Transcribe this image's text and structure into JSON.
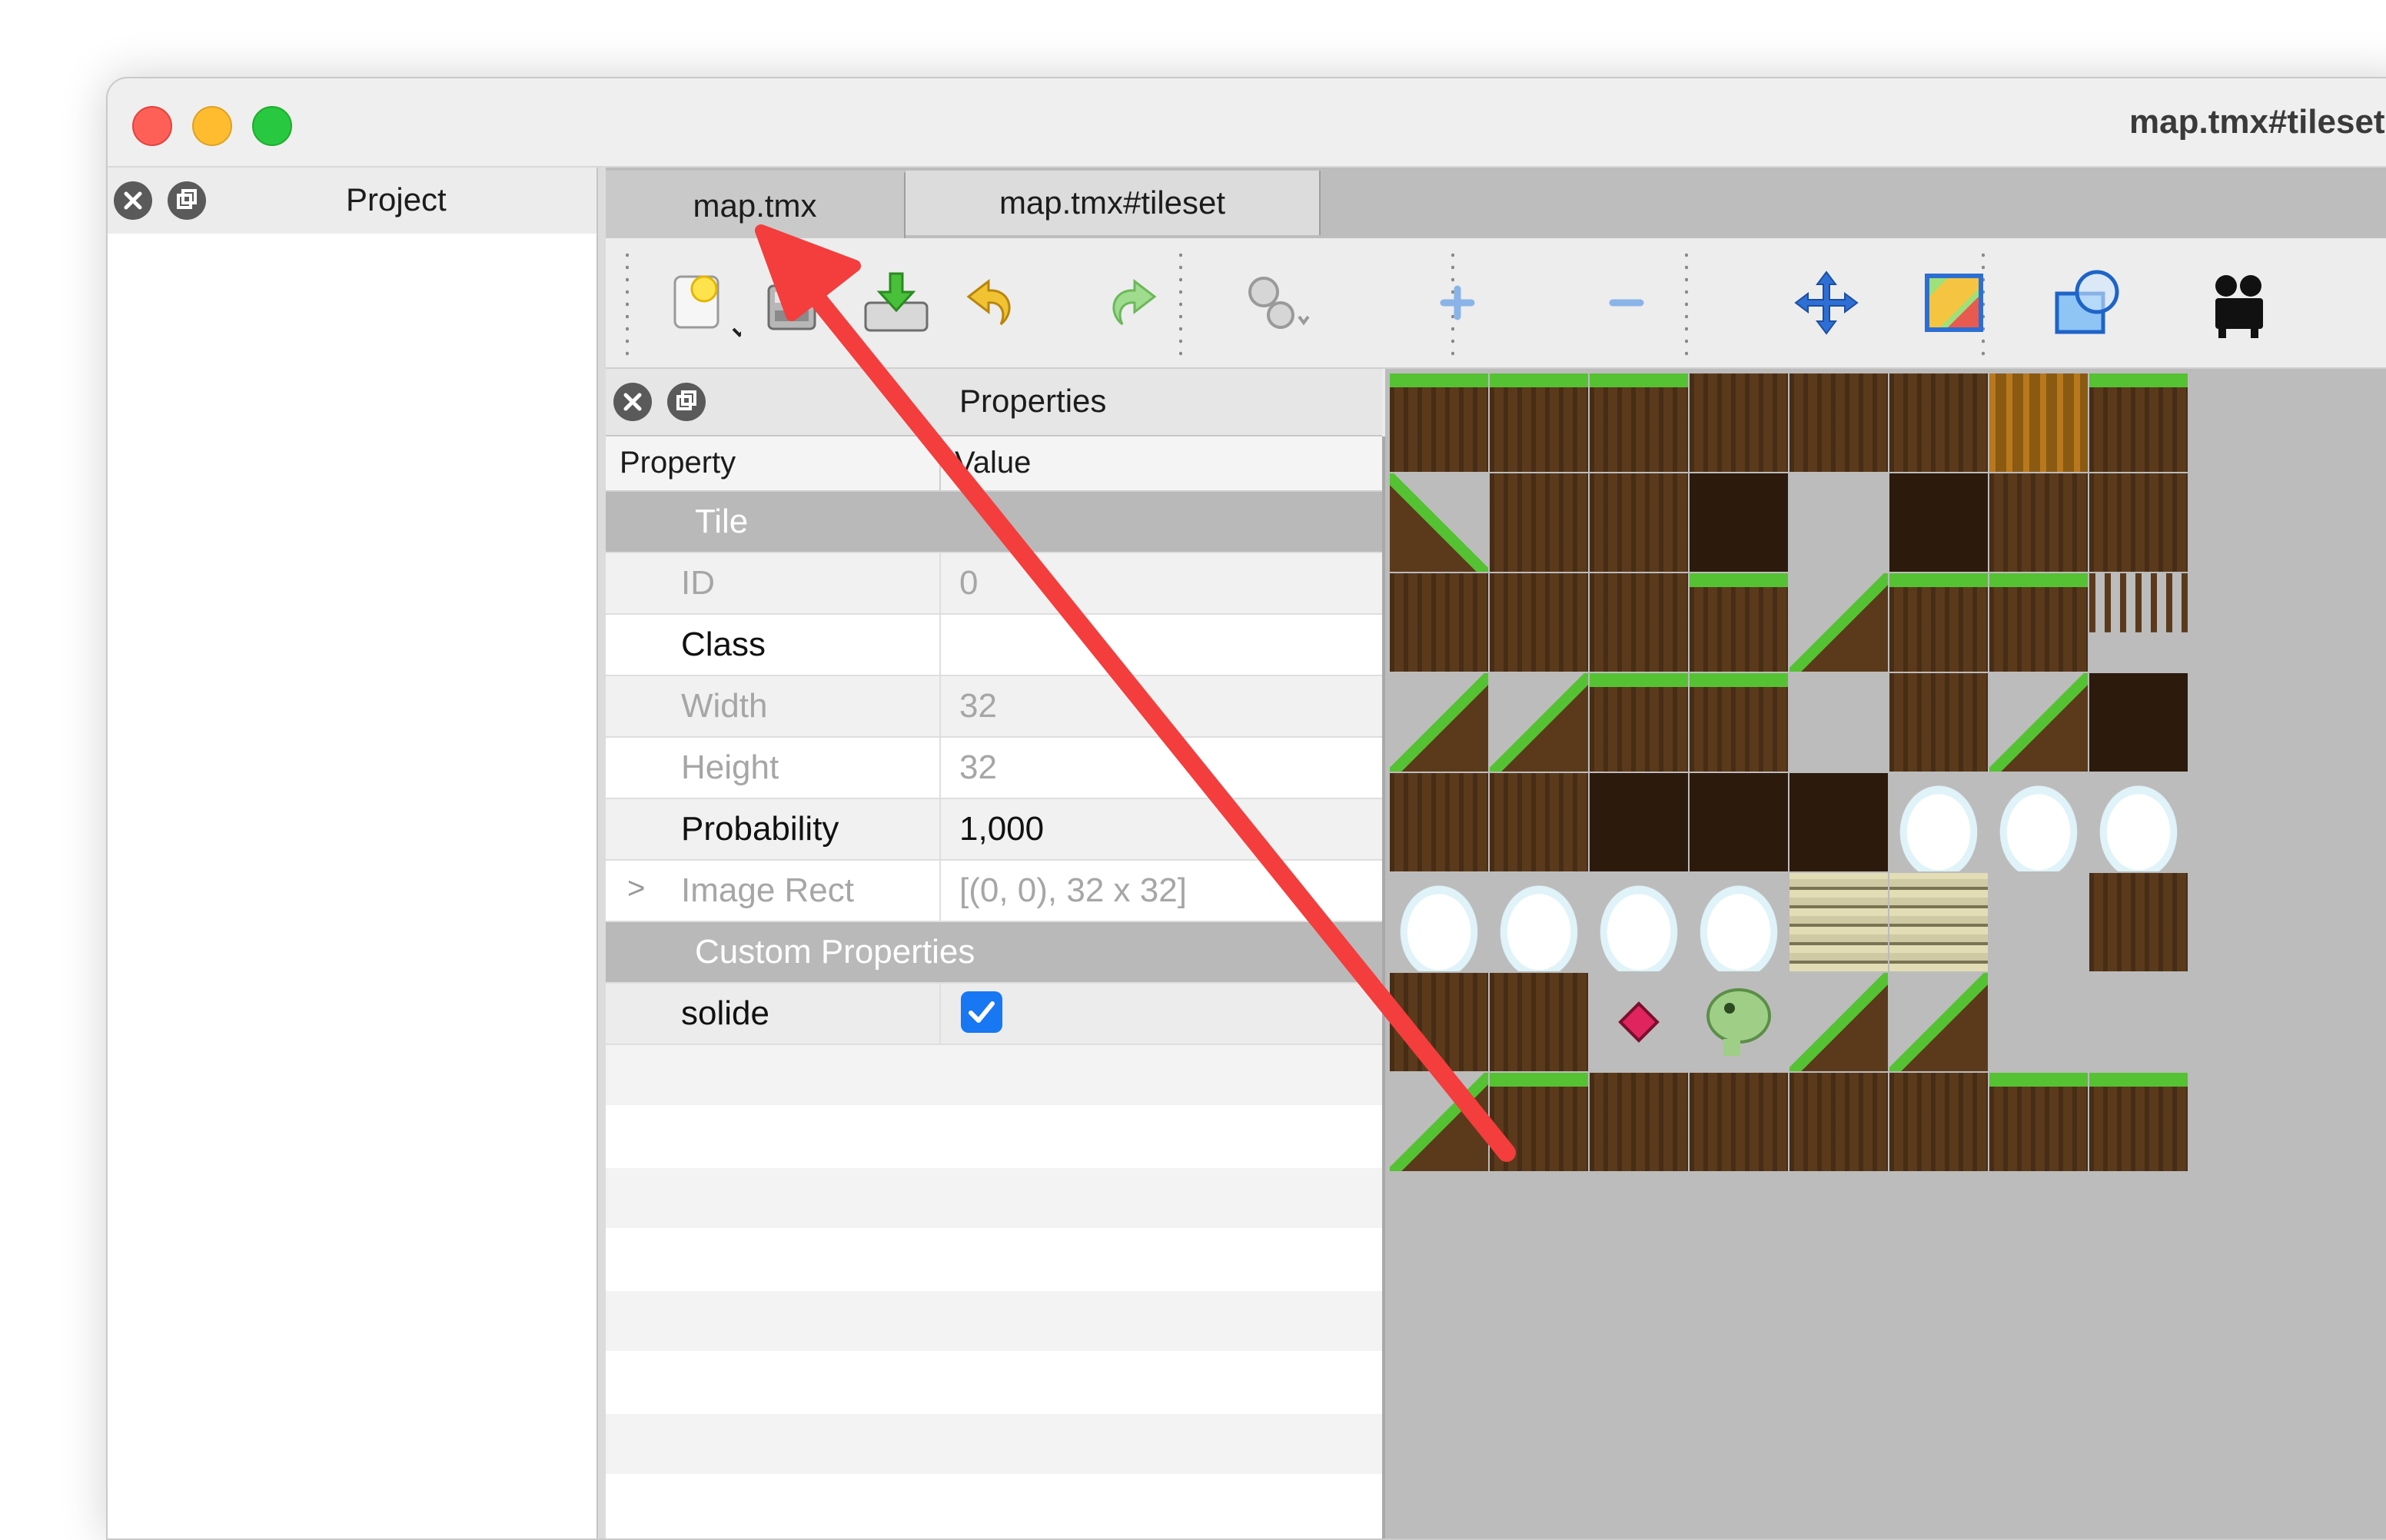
{
  "window": {
    "title": "map.tmx#tileset"
  },
  "project_dock": {
    "title": "Project"
  },
  "tabs": [
    {
      "label": "map.tmx",
      "active": false
    },
    {
      "label": "map.tmx#tileset",
      "active": true
    }
  ],
  "toolbar": {
    "icons": [
      "new-tileset-icon",
      "save-icon",
      "export-icon",
      "undo-icon",
      "redo-icon",
      "settings-icon",
      "add-icon",
      "remove-icon",
      "move-icon",
      "image-icon",
      "shapes-icon",
      "animation-icon"
    ]
  },
  "properties": {
    "title": "Properties",
    "columns": {
      "property": "Property",
      "value": "Value"
    },
    "groups": [
      {
        "label": "Tile"
      },
      {
        "label": "Custom Properties"
      }
    ],
    "rows": {
      "id": {
        "key": "ID",
        "value": "0"
      },
      "class": {
        "key": "Class",
        "value": ""
      },
      "width": {
        "key": "Width",
        "value": "32"
      },
      "height": {
        "key": "Height",
        "value": "32"
      },
      "probability": {
        "key": "Probability",
        "value": "1,000"
      },
      "image_rect": {
        "key": "Image Rect",
        "value": "[(0, 0), 32 x 32]"
      },
      "solide": {
        "key": "solide",
        "checked": true
      }
    }
  },
  "colors": {
    "accent": "#1877f2",
    "annotation_arrow": "#f43d3d",
    "grass": "#55c233",
    "dirt": "#5b3a1c"
  }
}
